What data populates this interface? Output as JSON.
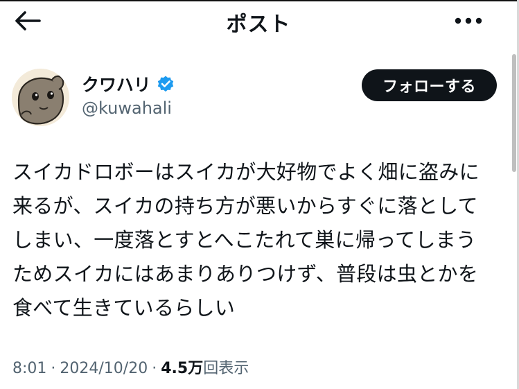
{
  "header": {
    "title": "ポスト",
    "back_icon": "arrow-left-icon",
    "more_icon": "more-horizontal-icon"
  },
  "author": {
    "name": "クワハリ",
    "handle": "@kuwahali",
    "verified": true,
    "verified_color": "#1d9bf0",
    "avatar_icon": "avatar-cartoon-character"
  },
  "follow_button": {
    "label": "フォローする"
  },
  "post": {
    "lines": [
      "スイカドロボーはスイカが大好物でよく畑に盗みに",
      "来るが、スイカの持ち方が悪いからすぐに落として",
      "しまい、一度落とすとへこたれて巣に帰ってしまう",
      "ためスイカにはあまりありつけず、普段は虫とかを",
      "食べて生きているらしい"
    ]
  },
  "meta": {
    "time": "8:01",
    "dot1": "·",
    "date": "2024/10/20",
    "dot2": "·",
    "views_count": "4.5万",
    "views_label": "回表示"
  },
  "colors": {
    "text": "#0f1419",
    "secondary": "#536471",
    "follow_bg": "#0f1419",
    "background": "#ffffff"
  }
}
